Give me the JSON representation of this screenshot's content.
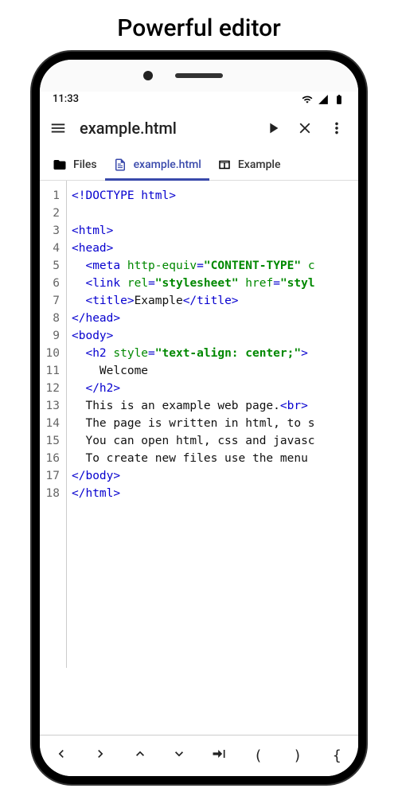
{
  "marketing": {
    "heading": "Powerful editor"
  },
  "status": {
    "time": "11:33"
  },
  "appbar": {
    "title": "example.html"
  },
  "tabs": {
    "files": "Files",
    "file": "example.html",
    "preview": "Example"
  },
  "code": {
    "lines": [
      [
        {
          "t": "tag",
          "s": "<!DOCTYPE html>"
        }
      ],
      [],
      [
        {
          "t": "tag",
          "s": "<html>"
        }
      ],
      [
        {
          "t": "tag",
          "s": "<head>"
        }
      ],
      [
        {
          "t": "text",
          "s": "  "
        },
        {
          "t": "tag",
          "s": "<meta "
        },
        {
          "t": "attr",
          "s": "http-equiv"
        },
        {
          "t": "tag",
          "s": "="
        },
        {
          "t": "val",
          "s": "\"CONTENT-TYPE\""
        },
        {
          "t": "attr",
          "s": " c"
        }
      ],
      [
        {
          "t": "text",
          "s": "  "
        },
        {
          "t": "tag",
          "s": "<link "
        },
        {
          "t": "attr",
          "s": "rel"
        },
        {
          "t": "tag",
          "s": "="
        },
        {
          "t": "val",
          "s": "\"stylesheet\""
        },
        {
          "t": "attr",
          "s": " href"
        },
        {
          "t": "tag",
          "s": "="
        },
        {
          "t": "val",
          "s": "\"styl"
        }
      ],
      [
        {
          "t": "text",
          "s": "  "
        },
        {
          "t": "tag",
          "s": "<title>"
        },
        {
          "t": "text",
          "s": "Example"
        },
        {
          "t": "tag",
          "s": "</title>"
        }
      ],
      [
        {
          "t": "tag",
          "s": "</head>"
        }
      ],
      [
        {
          "t": "tag",
          "s": "<body>"
        }
      ],
      [
        {
          "t": "text",
          "s": "  "
        },
        {
          "t": "tag",
          "s": "<h2 "
        },
        {
          "t": "attr",
          "s": "style"
        },
        {
          "t": "tag",
          "s": "="
        },
        {
          "t": "val",
          "s": "\"text-align: center;\""
        },
        {
          "t": "tag",
          "s": ">"
        }
      ],
      [
        {
          "t": "text",
          "s": "    Welcome"
        }
      ],
      [
        {
          "t": "text",
          "s": "  "
        },
        {
          "t": "tag",
          "s": "</h2>"
        }
      ],
      [
        {
          "t": "text",
          "s": "  This is an example web page."
        },
        {
          "t": "tag",
          "s": "<br>"
        }
      ],
      [
        {
          "t": "text",
          "s": "  The page is written in html, to s"
        }
      ],
      [
        {
          "t": "text",
          "s": "  You can open html, css and javasc"
        }
      ],
      [
        {
          "t": "text",
          "s": "  To create new files use the menu "
        }
      ],
      [
        {
          "t": "tag",
          "s": "</body>"
        }
      ],
      [
        {
          "t": "tag",
          "s": "</html>"
        }
      ]
    ]
  },
  "bottombar": {
    "lparen": "(",
    "rparen": ")",
    "lbrace": "{"
  }
}
